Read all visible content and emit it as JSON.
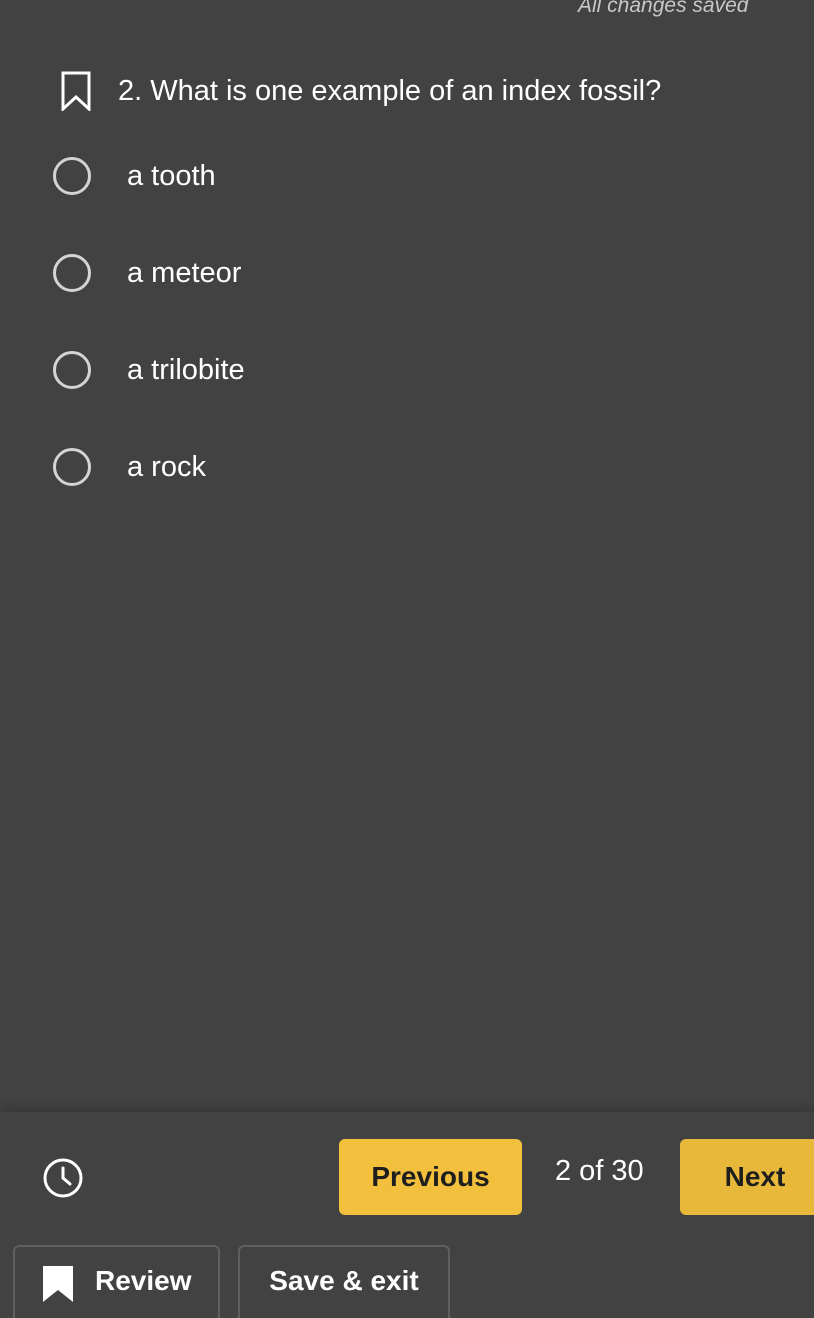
{
  "header": {
    "status_text": "All changes saved"
  },
  "question": {
    "text": "2. What is one example of an index fossil?",
    "bookmark_icon": "bookmark-outline-icon"
  },
  "options": [
    {
      "label": "a tooth",
      "selected": false
    },
    {
      "label": "a meteor",
      "selected": false
    },
    {
      "label": "a trilobite",
      "selected": false
    },
    {
      "label": "a rock",
      "selected": false
    }
  ],
  "footer": {
    "timer_icon": "clock-icon",
    "previous_label": "Previous",
    "counter": "2 of 30",
    "next_label": "Next",
    "review_label": "Review",
    "review_icon": "bookmark-filled-icon",
    "save_exit_label": "Save & exit"
  },
  "colors": {
    "background": "#424242",
    "accent": "#f2c03d",
    "text": "#ffffff"
  }
}
